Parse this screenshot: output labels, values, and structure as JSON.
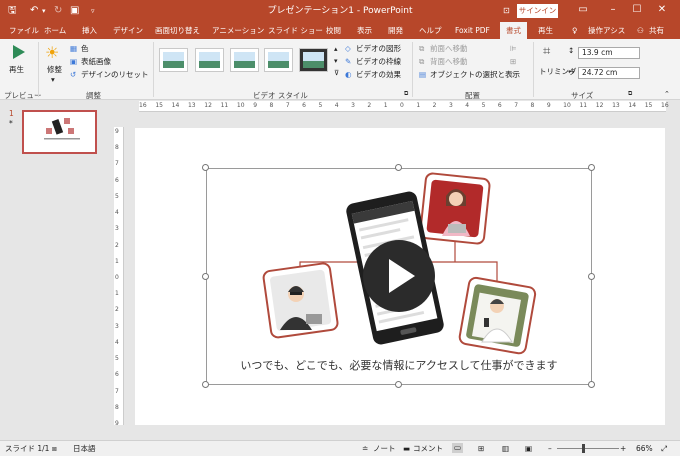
{
  "window": {
    "title": "プレゼンテーション1 - PowerPoint",
    "signin": "サインイン"
  },
  "tabs": [
    "ファイル",
    "ホーム",
    "挿入",
    "デザイン",
    "画面切り替え",
    "アニメーション",
    "スライド ショー",
    "校閲",
    "表示",
    "開発",
    "ヘルプ",
    "Foxit PDF",
    "書式",
    "再生"
  ],
  "active_tab": "書式",
  "tell_me": "操作アシス",
  "share": "共有",
  "ribbon": {
    "preview_button": "再生",
    "preview_group": "プレビュー",
    "correct_button": "修整",
    "color_button": "色",
    "poster_frame": "表紙画像",
    "reset_design": "デザインのリセット",
    "adjust_group": "調整",
    "video_styles_group": "ビデオ スタイル",
    "video_shape": "ビデオの図形",
    "video_border": "ビデオの枠線",
    "video_effects": "ビデオの効果",
    "bring_forward": "前面へ移動",
    "send_backward": "背面へ移動",
    "selection_pane": "オブジェクトの選択と表示",
    "arrange_group": "配置",
    "trimming": "トリミング",
    "height": "13.9 cm",
    "width": "24.72 cm",
    "size_group": "サイズ"
  },
  "slide_panel": {
    "number": "1",
    "star": "*"
  },
  "ruler": {
    "h_labels": [
      "16",
      "15",
      "14",
      "13",
      "12",
      "11",
      "10",
      "9",
      "8",
      "7",
      "6",
      "5",
      "4",
      "3",
      "2",
      "1",
      "0",
      "1",
      "2",
      "3",
      "4",
      "5",
      "6",
      "7",
      "8",
      "9",
      "10",
      "11",
      "12",
      "13",
      "14",
      "15",
      "16"
    ],
    "v_labels": [
      "9",
      "8",
      "7",
      "6",
      "5",
      "4",
      "3",
      "2",
      "1",
      "0",
      "1",
      "2",
      "3",
      "4",
      "5",
      "6",
      "7",
      "8",
      "9"
    ]
  },
  "slide": {
    "caption": "いつでも、どこでも、必要な情報にアクセスして仕事ができます"
  },
  "status": {
    "slide": "スライド 1/1",
    "language": "日本語",
    "notes": "ノート",
    "comments": "コメント",
    "zoom": "66%"
  },
  "colors": {
    "accent": "#b7472a",
    "frame": "#c0504d"
  }
}
